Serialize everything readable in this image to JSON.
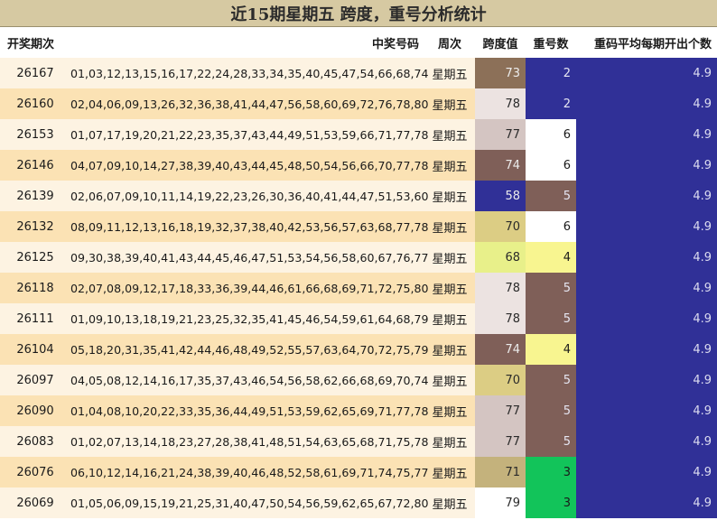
{
  "title": "近15期星期五 跨度，重号分析统计",
  "headers": {
    "period": "开奖期次",
    "numbers": "中奖号码",
    "weekday": "周次",
    "span": "跨度值",
    "repeat": "重号数",
    "avg": "重码平均每期开出个数"
  },
  "rows": [
    {
      "period": "26167",
      "numbers": "01,03,12,13,15,16,17,22,24,28,33,34,35,40,45,47,54,66,68,74",
      "weekday": "星期五",
      "span": "73",
      "repeat": "2",
      "avg": "4.9",
      "span_color": "#8c7058",
      "repeat_color": "#303097"
    },
    {
      "period": "26160",
      "numbers": "02,04,06,09,13,26,32,36,38,41,44,47,56,58,60,69,72,76,78,80",
      "weekday": "星期五",
      "span": "78",
      "repeat": "2",
      "avg": "4.9",
      "span_color": "#ece3e1",
      "repeat_color": "#303097"
    },
    {
      "period": "26153",
      "numbers": "01,07,17,19,20,21,22,23,35,37,43,44,49,51,53,59,66,71,77,78",
      "weekday": "星期五",
      "span": "77",
      "repeat": "6",
      "avg": "4.9",
      "span_color": "#d4c5c2",
      "repeat_color": "#ffffff"
    },
    {
      "period": "26146",
      "numbers": "04,07,09,10,14,27,38,39,40,43,44,45,48,50,54,56,66,70,77,78",
      "weekday": "星期五",
      "span": "74",
      "repeat": "6",
      "avg": "4.9",
      "span_color": "#7f5f58",
      "repeat_color": "#ffffff"
    },
    {
      "period": "26139",
      "numbers": "02,06,07,09,10,11,14,19,22,23,26,30,36,40,41,44,47,51,53,60",
      "weekday": "星期五",
      "span": "58",
      "repeat": "5",
      "avg": "4.9",
      "span_color": "#303097",
      "repeat_color": "#7f5f58"
    },
    {
      "period": "26132",
      "numbers": "08,09,11,12,13,16,18,19,32,37,38,40,42,53,56,57,63,68,77,78",
      "weekday": "星期五",
      "span": "70",
      "repeat": "6",
      "avg": "4.9",
      "span_color": "#dccd84",
      "repeat_color": "#ffffff"
    },
    {
      "period": "26125",
      "numbers": "09,30,38,39,40,41,43,44,45,46,47,51,53,54,56,58,60,67,76,77",
      "weekday": "星期五",
      "span": "68",
      "repeat": "4",
      "avg": "4.9",
      "span_color": "#e8f08a",
      "repeat_color": "#f8f590"
    },
    {
      "period": "26118",
      "numbers": "02,07,08,09,12,17,18,33,36,39,44,46,61,66,68,69,71,72,75,80",
      "weekday": "星期五",
      "span": "78",
      "repeat": "5",
      "avg": "4.9",
      "span_color": "#ece3e1",
      "repeat_color": "#7f5f58"
    },
    {
      "period": "26111",
      "numbers": "01,09,10,13,18,19,21,23,25,32,35,41,45,46,54,59,61,64,68,79",
      "weekday": "星期五",
      "span": "78",
      "repeat": "5",
      "avg": "4.9",
      "span_color": "#ece3e1",
      "repeat_color": "#7f5f58"
    },
    {
      "period": "26104",
      "numbers": "05,18,20,31,35,41,42,44,46,48,49,52,55,57,63,64,70,72,75,79",
      "weekday": "星期五",
      "span": "74",
      "repeat": "4",
      "avg": "4.9",
      "span_color": "#7f5f58",
      "repeat_color": "#f8f590"
    },
    {
      "period": "26097",
      "numbers": "04,05,08,12,14,16,17,35,37,43,46,54,56,58,62,66,68,69,70,74",
      "weekday": "星期五",
      "span": "70",
      "repeat": "5",
      "avg": "4.9",
      "span_color": "#dccd84",
      "repeat_color": "#7f5f58"
    },
    {
      "period": "26090",
      "numbers": "01,04,08,10,20,22,33,35,36,44,49,51,53,59,62,65,69,71,77,78",
      "weekday": "星期五",
      "span": "77",
      "repeat": "5",
      "avg": "4.9",
      "span_color": "#d4c5c2",
      "repeat_color": "#7f5f58"
    },
    {
      "period": "26083",
      "numbers": "01,02,07,13,14,18,23,27,28,38,41,48,51,54,63,65,68,71,75,78",
      "weekday": "星期五",
      "span": "77",
      "repeat": "5",
      "avg": "4.9",
      "span_color": "#d4c5c2",
      "repeat_color": "#7f5f58"
    },
    {
      "period": "26076",
      "numbers": "06,10,12,14,16,21,24,38,39,40,46,48,52,58,61,69,71,74,75,77",
      "weekday": "星期五",
      "span": "71",
      "repeat": "3",
      "avg": "4.9",
      "span_color": "#c4b27c",
      "repeat_color": "#12c45a"
    },
    {
      "period": "26069",
      "numbers": "01,05,06,09,15,19,21,25,31,40,47,50,54,56,59,62,65,67,72,80",
      "weekday": "星期五",
      "span": "79",
      "repeat": "3",
      "avg": "4.9",
      "span_color": "#ffffff",
      "repeat_color": "#12c45a"
    }
  ]
}
